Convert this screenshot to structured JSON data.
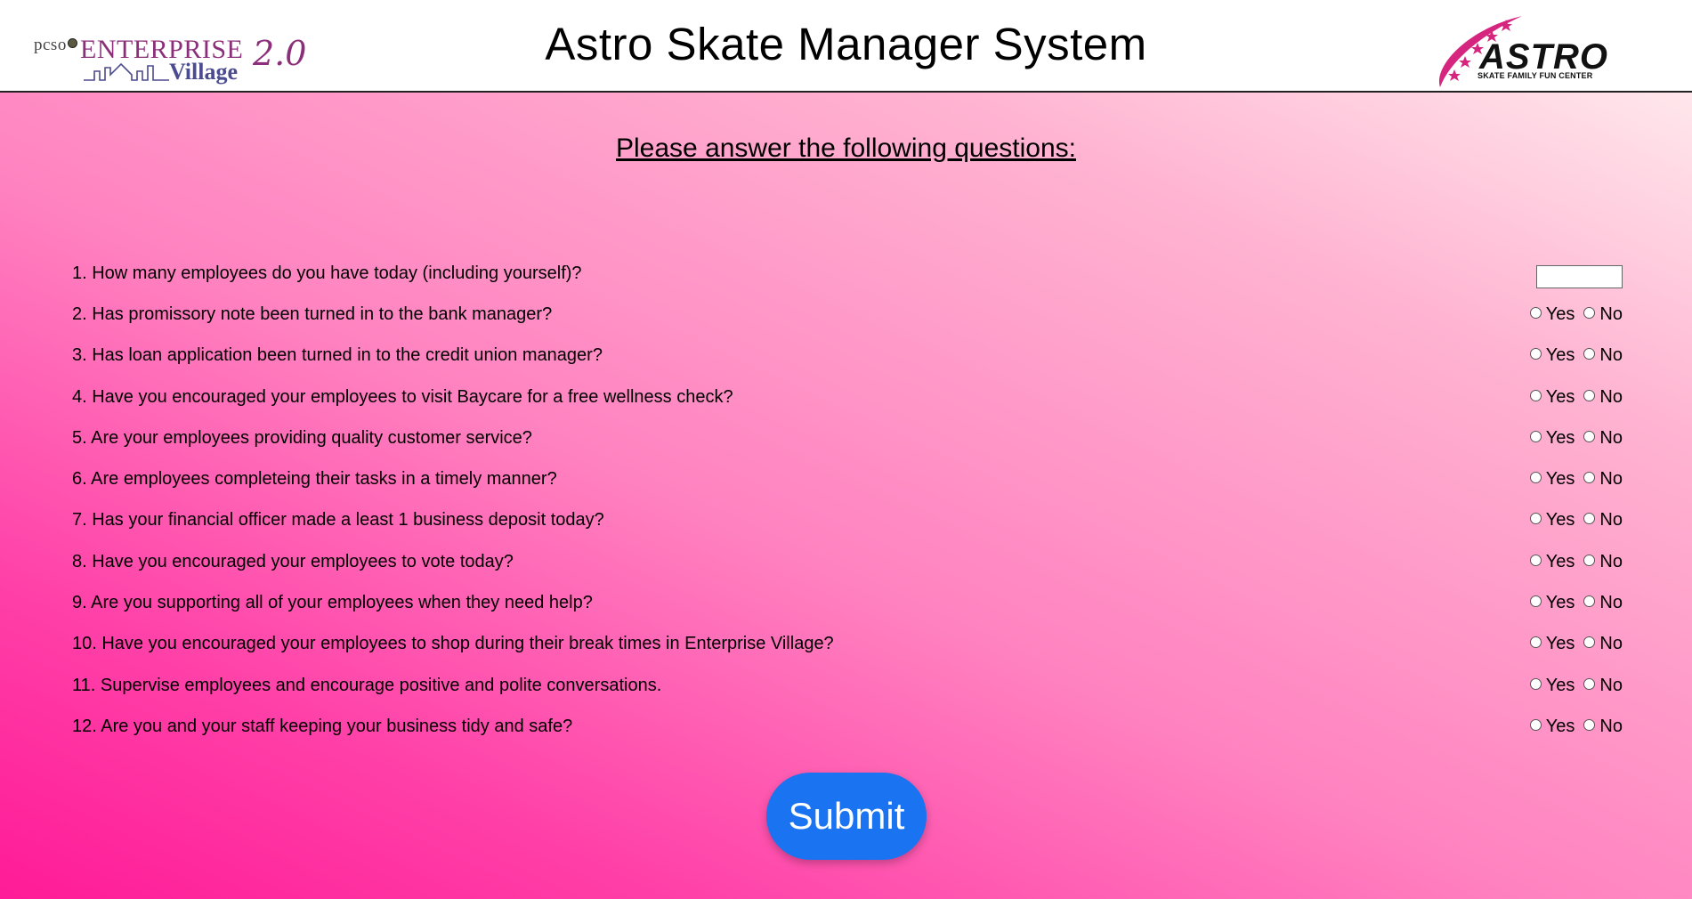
{
  "header": {
    "title": "Astro Skate Manager System",
    "left_logo": {
      "pcso": "pcso",
      "enterprise": "ENTERPRISE",
      "village": "Village",
      "version": "2.0"
    },
    "right_logo": {
      "name": "ASTRO",
      "tagline": "SKATE FAMILY FUN CENTER"
    }
  },
  "form": {
    "heading": "Please answer the following questions:",
    "yes_label": "Yes",
    "no_label": "No",
    "questions": [
      {
        "text": "1. How many employees do you have today (including yourself)?",
        "input": "number",
        "value": ""
      },
      {
        "text": "2. Has promissory note been turned in to the bank manager?",
        "input": "yesno"
      },
      {
        "text": "3. Has loan application been turned in to the credit union manager?",
        "input": "yesno"
      },
      {
        "text": "4. Have you encouraged your employees to visit Baycare for a free wellness check?",
        "input": "yesno"
      },
      {
        "text": "5. Are your employees providing quality customer service?",
        "input": "yesno"
      },
      {
        "text": "6. Are employees completeing their tasks in a timely manner?",
        "input": "yesno"
      },
      {
        "text": "7. Has your financial officer made a least 1 business deposit today?",
        "input": "yesno"
      },
      {
        "text": "8. Have you encouraged your employees to vote today?",
        "input": "yesno"
      },
      {
        "text": "9. Are you supporting all of your employees when they need help?",
        "input": "yesno"
      },
      {
        "text": "10. Have you encouraged your employees to shop during their break times in Enterprise Village?",
        "input": "yesno"
      },
      {
        "text": "11. Supervise employees and encourage positive and polite conversations.",
        "input": "yesno"
      },
      {
        "text": "12. Are you and your staff keeping your business tidy and safe?",
        "input": "yesno"
      }
    ],
    "submit_label": "Submit"
  },
  "colors": {
    "submit_button": "#1a73f0",
    "background_top": "#ffe7ec",
    "background_bottom": "#ff1b97",
    "logo_purple": "#8b2f7a",
    "logo_blue": "#4b4b90",
    "astro_magenta": "#d6257f"
  }
}
